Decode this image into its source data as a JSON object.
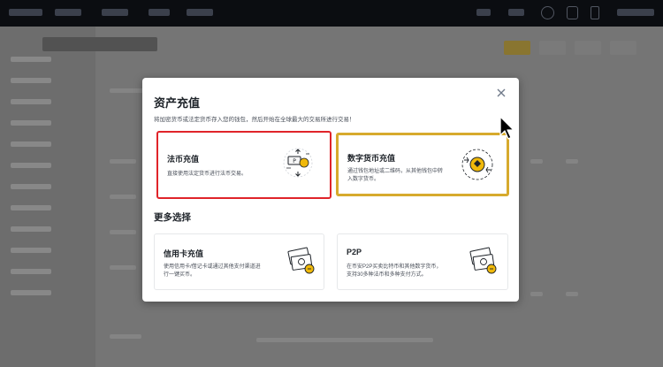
{
  "dialog": {
    "title": "资产充值",
    "subtitle": "将加密货币或法定货币存入您的钱包，然后开始在全球最大的交易所进行交易！",
    "close_icon": "close-icon",
    "options": [
      {
        "title": "法币充值",
        "description": "直接使用法定货币进行法币交易。",
        "icon": "fiat-exchange-icon",
        "highlight_color": "#e0242a"
      },
      {
        "title": "数字货币充值",
        "description_line1": "通过钱包地址或二维码，从其他钱包中转",
        "description_line2": "入数字货币。",
        "icon": "crypto-coin-icon",
        "highlight_color": "#d7aa2d"
      }
    ],
    "more_section_title": "更多选择",
    "more_options": [
      {
        "title": "信用卡充值",
        "description_line1": "使用信用卡/借记卡或通过其他支付渠道进",
        "description_line2": "行一键买币。",
        "icon": "card-payment-icon"
      },
      {
        "title": "P2P",
        "description_line1": "在币安P2P买卖比特币和其他数字货币，",
        "description_line2": "支持30多种法币和多种支付方式。",
        "icon": "p2p-payment-icon"
      }
    ]
  },
  "colors": {
    "accent_yellow": "#d7aa2d",
    "highlight_red": "#e0242a",
    "topbar": "#0c0e12"
  }
}
